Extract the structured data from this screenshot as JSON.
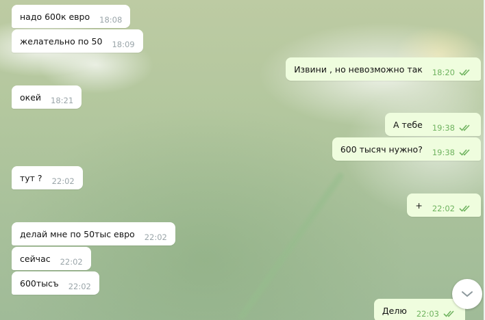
{
  "messages": [
    {
      "dir": "in",
      "text": "надо 600к евро",
      "time": "18:08"
    },
    {
      "dir": "in",
      "text": "желательно по 50",
      "time": "18:09"
    },
    {
      "dir": "out",
      "text": "Извини , но невозможно так",
      "time": "18:20"
    },
    {
      "dir": "in",
      "text": "окей",
      "time": "18:21"
    },
    {
      "dir": "out",
      "text": "А тебе",
      "time": "19:38"
    },
    {
      "dir": "out",
      "text": "600 тысяч нужно?",
      "time": "19:38"
    },
    {
      "dir": "in",
      "text": "тут ?",
      "time": "22:02"
    },
    {
      "dir": "out",
      "text": "+",
      "time": "22:02"
    },
    {
      "dir": "in",
      "text": "делай мне по 50тыс евро",
      "time": "22:02"
    },
    {
      "dir": "in",
      "text": "сейчас",
      "time": "22:02"
    },
    {
      "dir": "in",
      "text": "600тысъ",
      "time": "22:02"
    },
    {
      "dir": "out",
      "text": "Делю",
      "time": "22:03"
    }
  ],
  "status_colors": {
    "read_check": "#6fb35f",
    "incoming_time": "#9aa5a9"
  },
  "icons": {
    "read_receipt": "double-check-icon",
    "scroll_down": "chevron-down-icon"
  }
}
